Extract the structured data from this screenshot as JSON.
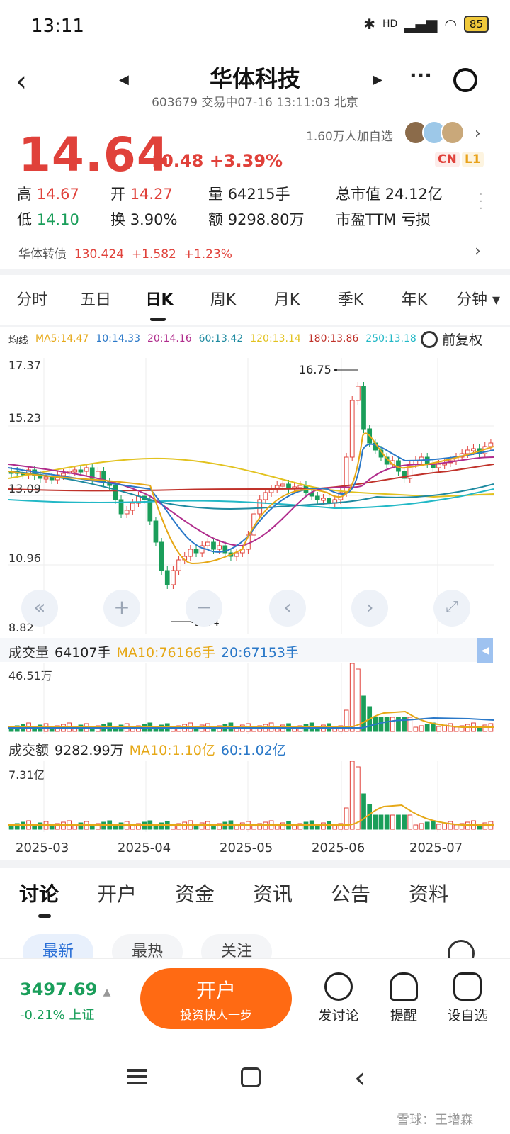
{
  "status": {
    "time": "13:11",
    "battery": "85",
    "hd": "HD"
  },
  "header": {
    "title": "华体科技",
    "subtitle": "603679 交易中07-16 13:11:03 北京"
  },
  "quote": {
    "price": "14.64",
    "change": "+0.48",
    "pct": "+3.39%",
    "followers": "1.60万人加自选",
    "tag_cn": "CN",
    "tag_l1": "L1"
  },
  "stats": {
    "high_l": "高",
    "high": "14.67",
    "low_l": "低",
    "low": "14.10",
    "open_l": "开",
    "open": "14.27",
    "turn_l": "换",
    "turn": "3.90%",
    "vol_l": "量",
    "vol": "64215手",
    "amt_l": "额",
    "amt": "9298.80万",
    "mcap_l": "总市值",
    "mcap": "24.12亿",
    "pe_l": "市盈TTM",
    "pe": "亏损"
  },
  "bond": {
    "name": "华体转债",
    "price": "130.424",
    "chg": "+1.582",
    "pct": "+1.23%"
  },
  "tabs": [
    "分时",
    "五日",
    "日K",
    "周K",
    "月K",
    "季K",
    "年K",
    "分钟 ▾"
  ],
  "ma": {
    "label": "均线",
    "ma5": "MA5:14.47",
    "ma10": "10:14.33",
    "ma20": "20:14.16",
    "ma60": "60:13.42",
    "ma120": "120:13.14",
    "ma180": "180:13.86",
    "ma250": "250:13.18",
    "adj": "前复权"
  },
  "yaxis": [
    "17.37",
    "15.23",
    "13.09",
    "10.96",
    "8.82"
  ],
  "markers": {
    "high": "16.75",
    "low": "9.44"
  },
  "vol": {
    "label": "成交量",
    "val": "64107手",
    "ma10": "MA10:76166手",
    "ma20": "20:67153手",
    "max": "46.51万"
  },
  "amt": {
    "label": "成交额",
    "val": "9282.99万",
    "ma10": "MA10:1.10亿",
    "ma60": "60:1.02亿",
    "max": "7.31亿"
  },
  "xaxis": [
    "2025-03",
    "2025-04",
    "2025-05",
    "2025-06",
    "2025-07"
  ],
  "bottom_tabs": [
    "讨论",
    "开户",
    "资金",
    "资讯",
    "公告",
    "资料"
  ],
  "subtabs": [
    "最新",
    "最热",
    "关注"
  ],
  "index": {
    "value": "3497.69",
    "chg": "-0.21% 上证"
  },
  "open_btn": {
    "main": "开户",
    "sub": "投资快人一步"
  },
  "actions": [
    "发讨论",
    "提醒",
    "设自选"
  ],
  "watermark": "雪球：王增森",
  "colors": {
    "up": "#e0413a",
    "down": "#1a9e5a",
    "accent": "#ff6a13"
  },
  "chart_data": {
    "type": "candlestick",
    "ylim": [
      8.82,
      17.37
    ],
    "x": [
      "2025-03",
      "2025-04",
      "2025-05",
      "2025-06",
      "2025-07"
    ],
    "high_mark": 16.75,
    "low_mark": 9.44
  }
}
